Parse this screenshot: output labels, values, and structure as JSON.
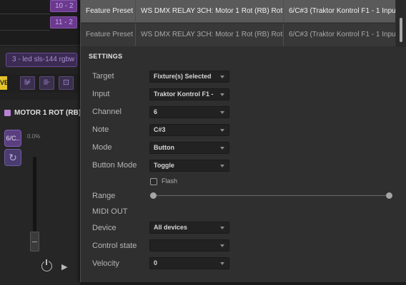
{
  "left": {
    "pills": [
      "10 - 2",
      "11 - 2"
    ],
    "layer_label": "3 - led sls-144 rgbw",
    "live_label": "VE",
    "tools": [
      {
        "icon": "fader-icon",
        "glyph": "⊯"
      },
      {
        "icon": "faders-icon",
        "glyph": "⊪"
      },
      {
        "icon": "crosshair-icon",
        "glyph": "⊡"
      }
    ],
    "fixture_name": "MOTOR 1 ROT (RB)",
    "cue_label": "6/C..",
    "cue_percent": "0.0%",
    "cue2_glyph": "↻",
    "play_glyph": "▶"
  },
  "presets": [
    {
      "type": "Feature Preset",
      "fixture": "WS DMX RELAY 3CH: Motor 1 Rot (RB) RotLeft",
      "mapping": "6/C#3 (Traktor Kontrol F1 - 1 Input)"
    },
    {
      "type": "Feature Preset",
      "fixture": "WS DMX RELAY 3CH: Motor 1 Rot (RB) RotLeft",
      "mapping": "6/C#3 (Traktor Kontrol F1 - 1 Input)"
    }
  ],
  "settings": {
    "heading": "SETTINGS",
    "target_label": "Target",
    "target_value": "Fixture(s) Selected",
    "input_label": "Input",
    "input_value": "Traktor Kontrol F1 -",
    "channel_label": "Channel",
    "channel_value": "6",
    "note_label": "Note",
    "note_value": "C#3",
    "mode_label": "Mode",
    "mode_value": "Button",
    "button_mode_label": "Button Mode",
    "button_mode_value": "Toggle",
    "flash_label": "Flash",
    "flash_checked": false,
    "range_label": "Range",
    "range_min": 0,
    "range_max": 1,
    "midi_out_heading": "MIDI OUT",
    "device_label": "Device",
    "device_value": "All devices",
    "control_state_label": "Control state",
    "control_state_value": "",
    "velocity_label": "Velocity",
    "velocity_value": "0"
  }
}
